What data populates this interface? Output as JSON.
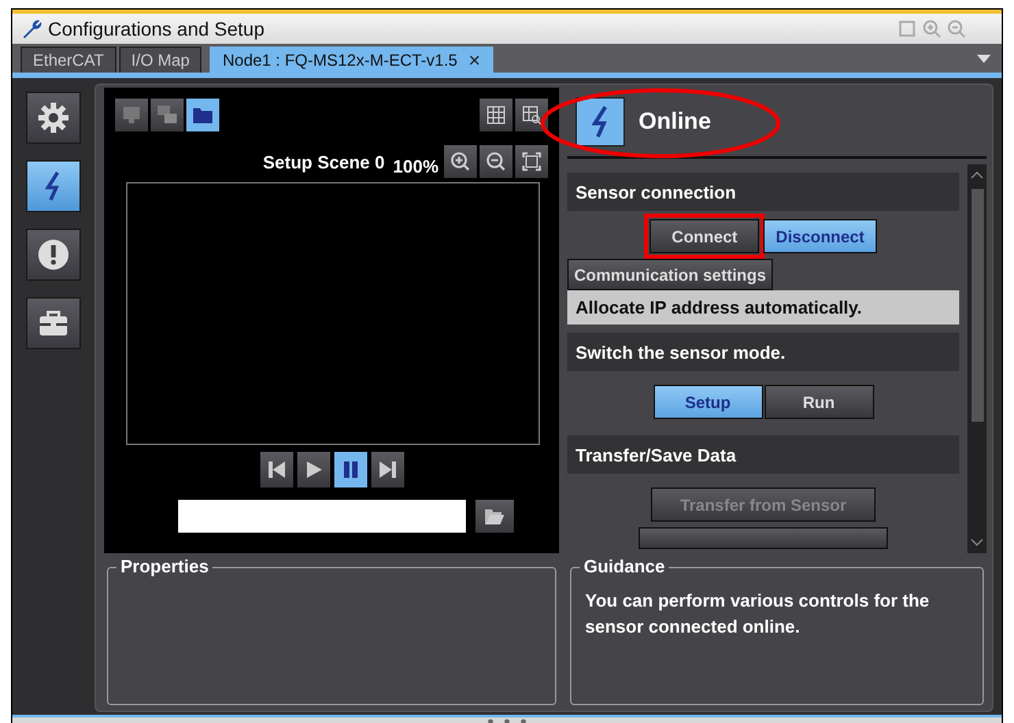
{
  "window": {
    "title": "Configurations and Setup"
  },
  "tabs": [
    {
      "label": "EtherCAT",
      "selected": false
    },
    {
      "label": "I/O Map",
      "selected": false
    },
    {
      "label": "Node1 : FQ-MS12x-M-ECT-v1.5",
      "selected": true
    }
  ],
  "close_tab": "×",
  "sidebar": {
    "items": [
      {
        "kind": "settings",
        "selected": false
      },
      {
        "kind": "online",
        "selected": true
      },
      {
        "kind": "alert",
        "selected": false
      },
      {
        "kind": "toolbox",
        "selected": false
      }
    ]
  },
  "image_view": {
    "view_buttons": [
      {
        "kind": "monitor",
        "selected": false
      },
      {
        "kind": "monitors",
        "selected": false
      },
      {
        "kind": "folder",
        "selected": true
      }
    ],
    "scene": "Setup Scene 0",
    "zoom": "100%",
    "playback": [
      {
        "kind": "first",
        "selected": false
      },
      {
        "kind": "play",
        "selected": false
      },
      {
        "kind": "pause",
        "selected": true
      },
      {
        "kind": "last",
        "selected": false
      }
    ]
  },
  "properties": {
    "title": "Properties"
  },
  "online_panel": {
    "title": "Online",
    "circled": true,
    "sensor_connection": {
      "heading": "Sensor connection",
      "buttons": [
        {
          "label": "Connect",
          "selected": false,
          "highlighted": true
        },
        {
          "label": "Disconnect",
          "selected": true,
          "highlighted": false
        }
      ],
      "settings_button": "Communication settings",
      "ip_mode": "Allocate IP address automatically."
    },
    "sensor_mode": {
      "heading": "Switch the sensor mode.",
      "modes": [
        {
          "label": "Setup",
          "selected": true
        },
        {
          "label": "Run",
          "selected": false
        }
      ]
    },
    "transfer": {
      "heading": "Transfer/Save Data",
      "buttons": [
        {
          "label": "Transfer from Sensor",
          "disabled": true
        }
      ]
    }
  },
  "guidance": {
    "title": "Guidance",
    "text": "You can perform various controls for the sensor connected online."
  }
}
